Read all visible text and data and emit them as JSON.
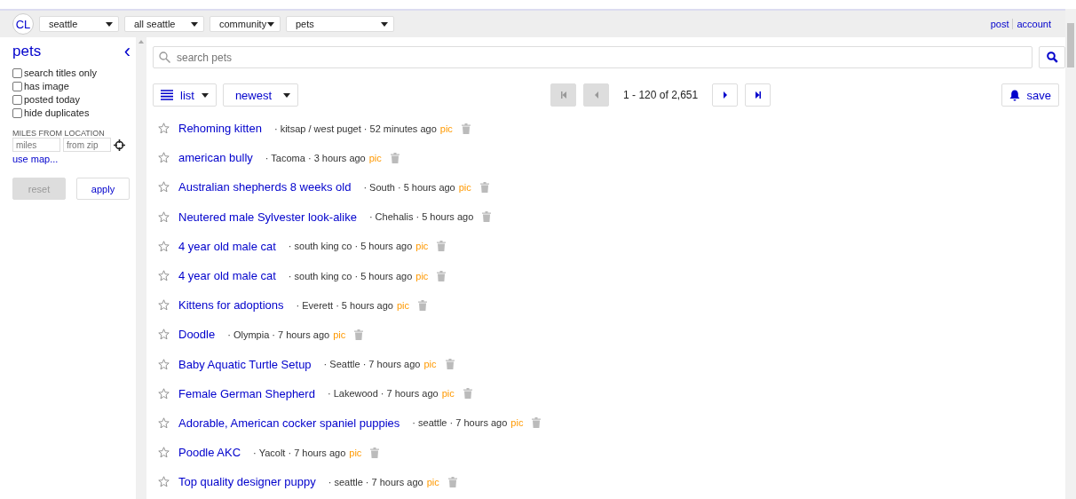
{
  "header": {
    "logo": "CL",
    "dropdowns": [
      {
        "value": "seattle"
      },
      {
        "value": "all seattle"
      },
      {
        "value": "community"
      },
      {
        "value": "pets"
      }
    ],
    "links": [
      "post",
      "account"
    ]
  },
  "sidebar": {
    "title": "pets",
    "collapse": "‹",
    "filters": [
      {
        "label": "search titles only",
        "checked": false
      },
      {
        "label": "has image",
        "checked": false
      },
      {
        "label": "posted today",
        "checked": false
      },
      {
        "label": "hide duplicates",
        "checked": false
      }
    ],
    "distance": {
      "label": "MILES FROM LOCATION",
      "miles_placeholder": "miles",
      "zip_placeholder": "from zip",
      "map_link": "use map..."
    },
    "buttons": [
      {
        "label": "reset",
        "disabled": true
      },
      {
        "label": "apply",
        "disabled": false
      }
    ]
  },
  "search": {
    "placeholder": "search pets"
  },
  "toolbar": {
    "view": "list",
    "sort": "newest",
    "pager": {
      "first_disabled": true,
      "prev_disabled": true,
      "range": "1 - 120 of 2,651",
      "next_disabled": false,
      "last_disabled": false
    },
    "save": "save"
  },
  "listings": [
    {
      "title": "Rehoming kitten",
      "meta": "· kitsap / west puget · 52 minutes ago",
      "pic": "pic",
      "favorite": false
    },
    {
      "title": "american bully",
      "meta": "· Tacoma · 3 hours ago",
      "pic": "pic",
      "favorite": false
    },
    {
      "title": "Australian shepherds 8 weeks old",
      "meta": "· South · 5 hours ago",
      "pic": "pic",
      "favorite": false
    },
    {
      "title": "Neutered male Sylvester look-alike",
      "meta": "· Chehalis · 5 hours ago",
      "favorite": false
    },
    {
      "title": "4 year old male cat",
      "meta": "· south king co · 5 hours ago",
      "pic": "pic",
      "favorite": false
    },
    {
      "title": "4 year old male cat",
      "meta": "· south king co · 5 hours ago",
      "pic": "pic",
      "favorite": false
    },
    {
      "title": "Kittens for adoptions",
      "meta": "· Everett · 5 hours ago",
      "pic": "pic",
      "favorite": false
    },
    {
      "title": "Doodle",
      "meta": "· Olympia · 7 hours ago",
      "pic": "pic",
      "favorite": false
    },
    {
      "title": "Baby Aquatic Turtle Setup",
      "meta": "· Seattle · 7 hours ago",
      "pic": "pic",
      "favorite": false
    },
    {
      "title": "Female German Shepherd",
      "meta": "· Lakewood · 7 hours ago",
      "pic": "pic",
      "favorite": false
    },
    {
      "title": "Adorable, American cocker spaniel puppies",
      "meta": "· seattle · 7 hours ago",
      "pic": "pic",
      "favorite": false
    },
    {
      "title": "Poodle AKC",
      "meta": "· Yacolt · 7 hours ago",
      "pic": "pic",
      "favorite": false
    },
    {
      "title": "Top quality designer puppy",
      "meta": "· seattle · 7 hours ago",
      "pic": "pic",
      "favorite": false
    }
  ]
}
